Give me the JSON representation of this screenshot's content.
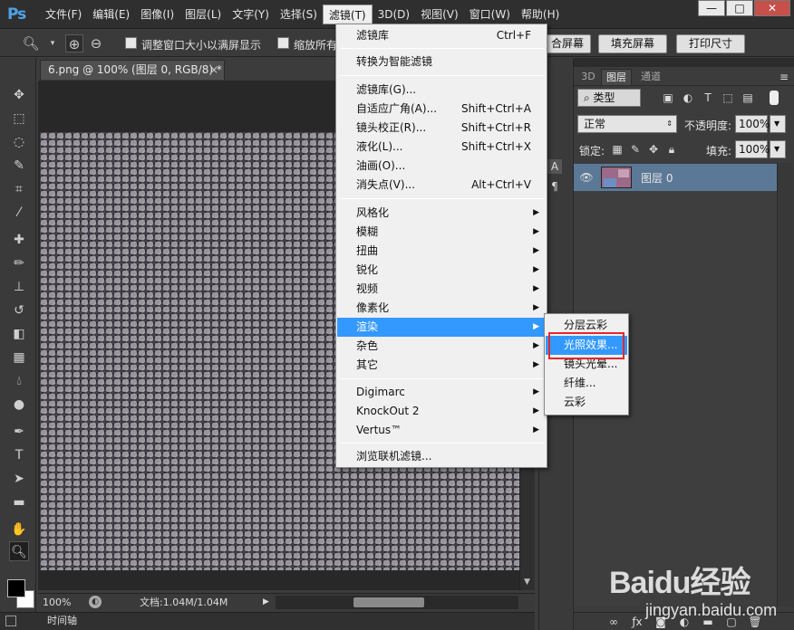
{
  "app": {
    "logo": "Ps"
  },
  "menubar": {
    "items": [
      "文件(F)",
      "编辑(E)",
      "图像(I)",
      "图层(L)",
      "文字(Y)",
      "选择(S)",
      "滤镜(T)",
      "3D(D)",
      "视图(V)",
      "窗口(W)",
      "帮助(H)"
    ],
    "active_index": 6,
    "window_buttons": [
      "—",
      "□",
      "✕"
    ]
  },
  "options": {
    "checkbox1_label": "调整窗口大小以满屏显示",
    "checkbox2_label": "缩放所有",
    "btn_fit": "合屏幕",
    "btn_fill": "填充屏幕",
    "btn_print": "打印尺寸"
  },
  "document": {
    "tab_title": "6.png @ 100% (图层 0, RGB/8) *",
    "tab_close": "×",
    "zoom": "100%",
    "doc_info": "文档:1.04M/1.04M",
    "timeline_label": "时间轴"
  },
  "filter_menu": {
    "items": [
      {
        "label": "滤镜库",
        "shortcut": "Ctrl+F"
      },
      {
        "label": "转换为智能滤镜"
      },
      {
        "label": "滤镜库(G)..."
      },
      {
        "label": "自适应广角(A)...",
        "shortcut": "Shift+Ctrl+A"
      },
      {
        "label": "镜头校正(R)...",
        "shortcut": "Shift+Ctrl+R"
      },
      {
        "label": "液化(L)...",
        "shortcut": "Shift+Ctrl+X"
      },
      {
        "label": "油画(O)..."
      },
      {
        "label": "消失点(V)...",
        "shortcut": "Alt+Ctrl+V"
      },
      {
        "label": "风格化",
        "submenu": true
      },
      {
        "label": "模糊",
        "submenu": true
      },
      {
        "label": "扭曲",
        "submenu": true
      },
      {
        "label": "锐化",
        "submenu": true
      },
      {
        "label": "视频",
        "submenu": true
      },
      {
        "label": "像素化",
        "submenu": true
      },
      {
        "label": "渲染",
        "submenu": true,
        "highlighted": true
      },
      {
        "label": "杂色",
        "submenu": true
      },
      {
        "label": "其它",
        "submenu": true
      },
      {
        "label": "Digimarc",
        "submenu": true
      },
      {
        "label": "KnockOut 2",
        "submenu": true
      },
      {
        "label": "Vertus™",
        "submenu": true
      },
      {
        "label": "浏览联机滤镜..."
      }
    ]
  },
  "render_submenu": {
    "items": [
      "分层云彩",
      "光照效果...",
      "镜头光晕...",
      "纤维...",
      "云彩"
    ],
    "highlighted_index": 1
  },
  "layers_panel": {
    "tabs": [
      "3D",
      "图层",
      "通道"
    ],
    "active_tab": 1,
    "filter_kind": "类型",
    "blend_mode": "正常",
    "opacity_label": "不透明度:",
    "opacity_value": "100%",
    "lock_label": "锁定:",
    "fill_label": "填充:",
    "fill_value": "100%",
    "layer_name": "图层 0"
  },
  "watermark": {
    "logo": "Baidu经验",
    "url": "jingyan.baidu.com"
  },
  "colors": {
    "highlight": "#3399ff",
    "annotation_box": "#e8262b",
    "selected_layer": "#5b7896"
  }
}
